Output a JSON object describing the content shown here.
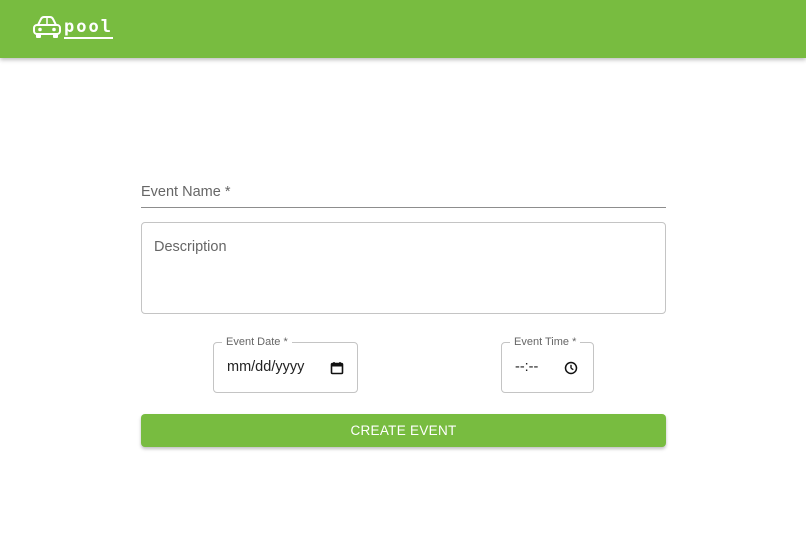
{
  "appbar": {
    "logo_icon": "car-icon",
    "logo_text": "pool",
    "brand_color": "#78bc40"
  },
  "form": {
    "event_name": {
      "label": "Event Name *",
      "value": ""
    },
    "description": {
      "label": "Description",
      "value": ""
    },
    "event_date": {
      "label": "Event Date *",
      "value": "mm/dd/yyyy",
      "icon": "calendar-icon"
    },
    "event_time": {
      "label": "Event Time *",
      "value": "--:--",
      "icon": "clock-icon"
    },
    "submit_label": "CREATE EVENT"
  }
}
